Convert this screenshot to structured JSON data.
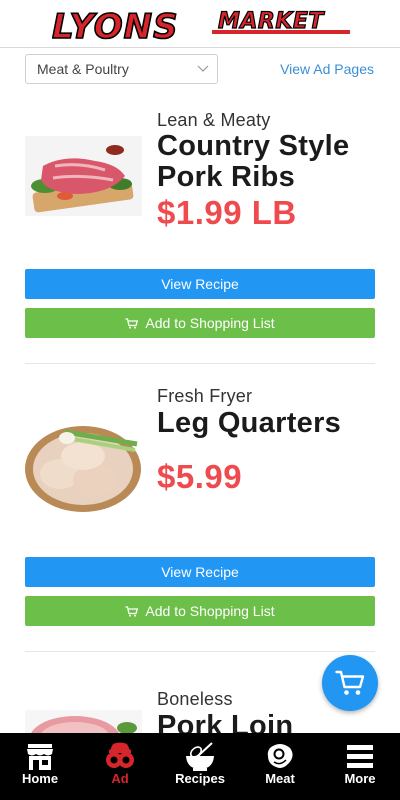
{
  "header": {
    "logo_text_1": "LYONS",
    "logo_text_2": "MARKET",
    "brand_color": "#d6262c"
  },
  "filter": {
    "category_selected": "Meat & Poultry",
    "view_ad_pages": "View Ad Pages"
  },
  "items": [
    {
      "subtitle": "Lean & Meaty",
      "title_line1": "Country Style",
      "title_line2": "Pork Ribs",
      "price": "$1.99 LB",
      "view_recipe": "View Recipe",
      "add_to_list": "Add to Shopping List",
      "image_icon": "pork-ribs-image"
    },
    {
      "subtitle": "Fresh Fryer",
      "title_line1": "Leg Quarters",
      "price": "$5.99",
      "view_recipe": "View Recipe",
      "add_to_list": "Add to Shopping List",
      "image_icon": "chicken-legs-image"
    },
    {
      "subtitle": "Boneless",
      "title_line1": "Pork Loin",
      "image_icon": "pork-loin-image"
    }
  ],
  "nav": [
    {
      "label": "Home",
      "icon": "store-icon"
    },
    {
      "label": "Ad",
      "icon": "ad-icon",
      "active": true
    },
    {
      "label": "Recipes",
      "icon": "whisk-bowl-icon"
    },
    {
      "label": "Meat",
      "icon": "steak-icon"
    },
    {
      "label": "More",
      "icon": "menu-icon"
    }
  ],
  "colors": {
    "accent_blue": "#2196f3",
    "accent_green": "#6cc04a",
    "price_red": "#ef4a4e",
    "link_blue": "#3a8fd6"
  }
}
